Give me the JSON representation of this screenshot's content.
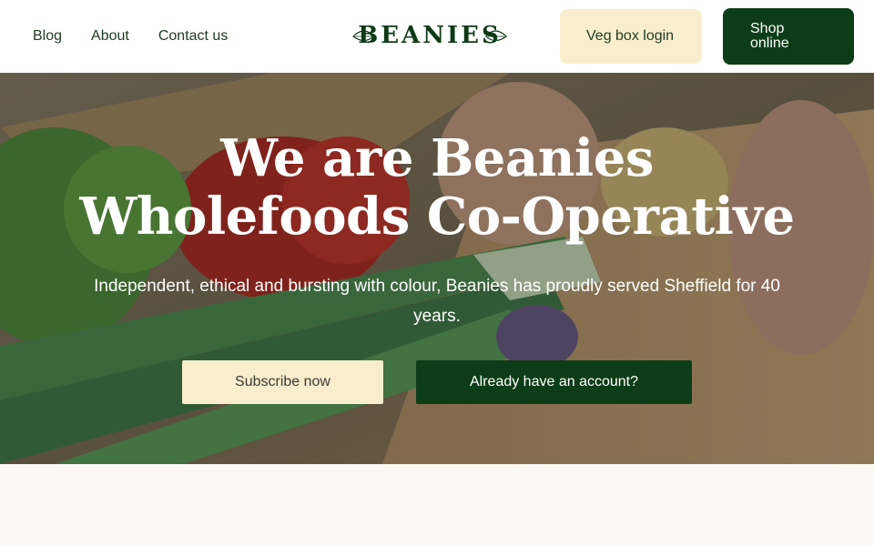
{
  "nav": {
    "items": [
      {
        "label": "Blog"
      },
      {
        "label": "About"
      },
      {
        "label": "Contact us"
      }
    ]
  },
  "logo": {
    "text": "BEANIES"
  },
  "header": {
    "login_label": "Veg box login",
    "shop_label": "Shop online"
  },
  "hero": {
    "title_line1": "We are Beanies",
    "title_line2": "Wholefoods Co-Operative",
    "subtitle": "Independent, ethical and bursting with colour, Beanies has proudly served Sheffield for 40 years.",
    "subscribe_label": "Subscribe now",
    "account_label": "Already have an account?"
  },
  "colors": {
    "brand_green": "#0d3d18",
    "cream": "#f8edcd",
    "page_bg": "#fdf8f4"
  }
}
